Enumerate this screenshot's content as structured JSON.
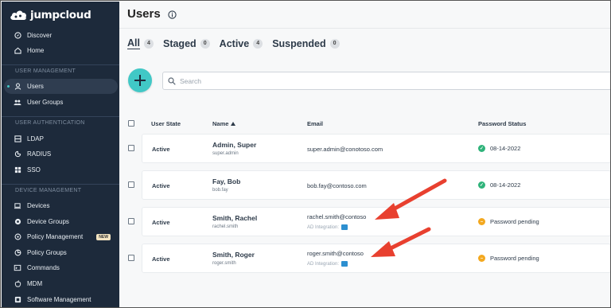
{
  "brand": {
    "name": "jumpcloud"
  },
  "sidebar": {
    "top_items": [
      {
        "label": "Discover",
        "icon": "compass-icon"
      },
      {
        "label": "Home",
        "icon": "home-icon"
      }
    ],
    "sections": [
      {
        "title": "USER MANAGEMENT",
        "items": [
          {
            "label": "Users",
            "icon": "user-icon",
            "active": true
          },
          {
            "label": "User Groups",
            "icon": "users-group-icon"
          }
        ]
      },
      {
        "title": "USER AUTHENTICATION",
        "items": [
          {
            "label": "LDAP",
            "icon": "ldap-icon"
          },
          {
            "label": "RADIUS",
            "icon": "radius-icon"
          },
          {
            "label": "SSO",
            "icon": "sso-icon"
          }
        ]
      },
      {
        "title": "DEVICE MANAGEMENT",
        "items": [
          {
            "label": "Devices",
            "icon": "device-icon"
          },
          {
            "label": "Device Groups",
            "icon": "device-group-icon"
          },
          {
            "label": "Policy Management",
            "icon": "policy-icon",
            "badge": "NEW"
          },
          {
            "label": "Policy Groups",
            "icon": "policy-group-icon"
          },
          {
            "label": "Commands",
            "icon": "command-icon"
          },
          {
            "label": "MDM",
            "icon": "apple-icon"
          },
          {
            "label": "Software Management",
            "icon": "software-icon"
          }
        ]
      }
    ]
  },
  "page": {
    "title": "Users"
  },
  "tabs": [
    {
      "label": "All",
      "count": "4",
      "active": true
    },
    {
      "label": "Staged",
      "count": "0"
    },
    {
      "label": "Active",
      "count": "4"
    },
    {
      "label": "Suspended",
      "count": "0"
    }
  ],
  "search": {
    "placeholder": "Search"
  },
  "table": {
    "columns": {
      "state": "User State",
      "name": "Name",
      "email": "Email",
      "password": "Password Status"
    },
    "rows": [
      {
        "state": "Active",
        "name": "Admin, Super",
        "username": "super.admin",
        "email": "super.admin@conotoso.com",
        "ad_label": "",
        "password_status": "08-14-2022",
        "status_type": "ok"
      },
      {
        "state": "Active",
        "name": "Fay, Bob",
        "username": "bob.fay",
        "email": "bob.fay@contoso.com",
        "ad_label": "",
        "password_status": "08-14-2022",
        "status_type": "ok"
      },
      {
        "state": "Active",
        "name": "Smith, Rachel",
        "username": "rachel.smith",
        "email": "rachel.smith@contoso",
        "ad_label": "AD Integration:",
        "password_status": "Password pending",
        "status_type": "pending"
      },
      {
        "state": "Active",
        "name": "Smith, Roger",
        "username": "roger.smith",
        "email": "roger.smith@contoso",
        "ad_label": "AD Integration:",
        "password_status": "Password pending",
        "status_type": "pending"
      }
    ]
  },
  "colors": {
    "sidebar_bg": "#1d2a3b",
    "accent": "#41c8c6",
    "ok": "#2fb37a",
    "pending": "#f3a81f",
    "arrow": "#e8402f"
  }
}
